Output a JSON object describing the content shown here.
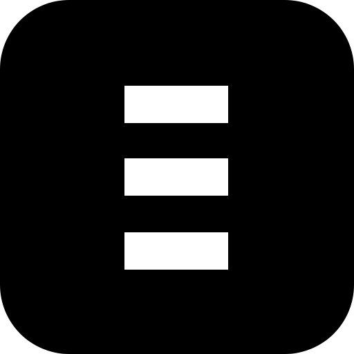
{
  "icon": {
    "name": "menu-icon",
    "background_color": "#000000",
    "bar_color": "#ffffff"
  }
}
